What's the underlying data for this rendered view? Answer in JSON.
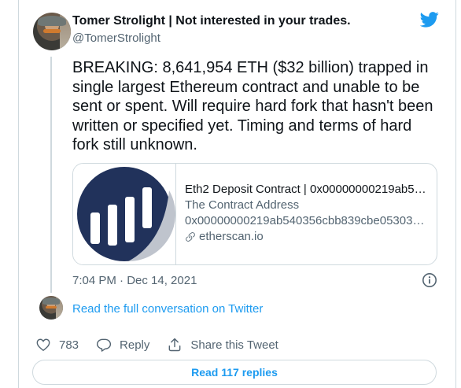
{
  "author": {
    "name": "Tomer Strolight | Not interested in your trades.",
    "handle": "@TomerStrolight"
  },
  "tweet": {
    "text": "BREAKING: 8,641,954 ETH ($32 billion) trapped in single largest Ethereum contract and unable to be sent or spent. Will require hard fork that hasn't been written or specified yet. Timing and terms of hard fork still unknown.",
    "timestamp": "7:04 PM · Dec 14, 2021"
  },
  "link_card": {
    "title": "Eth2 Deposit Contract | 0x00000000219ab54...",
    "description": "The Contract Address",
    "address": "0x00000000219ab540356cbb839cbe05303d...",
    "domain": "etherscan.io"
  },
  "conversation": {
    "read_full_label": "Read the full conversation on Twitter"
  },
  "actions": {
    "like_count": "783",
    "reply_label": "Reply",
    "share_label": "Share this Tweet"
  },
  "read_replies_label": "Read 117 replies",
  "colors": {
    "accent": "#1d9bf0",
    "text": "#0f1419",
    "secondary": "#536471",
    "border": "#cfd9de",
    "thumb_circle": "#21325b"
  }
}
